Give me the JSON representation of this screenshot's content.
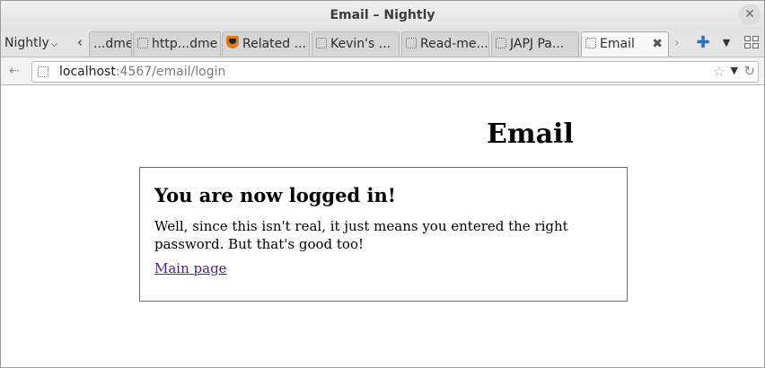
{
  "window": {
    "title": "Email – Nightly",
    "close_symbol": "✕"
  },
  "tabbar": {
    "menu_label": "Nightly",
    "tabs": [
      {
        "label": "...dme",
        "favicon": "blank-page-icon"
      },
      {
        "label": "http...dme",
        "favicon": "blank-page-icon"
      },
      {
        "label": "Related ...",
        "favicon": "shield-icon"
      },
      {
        "label": "Kevin's ...",
        "favicon": "blank-page-icon"
      },
      {
        "label": "Read-me...",
        "favicon": "blank-page-icon"
      },
      {
        "label": "JAPJ Pa...",
        "favicon": "blank-page-icon"
      },
      {
        "label": "Email",
        "favicon": "blank-page-icon",
        "active": true
      }
    ]
  },
  "navbar": {
    "url_host": "localhost",
    "url_path": ":4567/email/login"
  },
  "page": {
    "heading": "Email",
    "box": {
      "title": "You are now logged in!",
      "message": "Well, since this isn't real, it just means you entered the right password. But that's good too!",
      "link": "Main page"
    }
  },
  "colors": {
    "link_visited": "#551a8b",
    "new_tab_blue": "#2a6fc0"
  }
}
